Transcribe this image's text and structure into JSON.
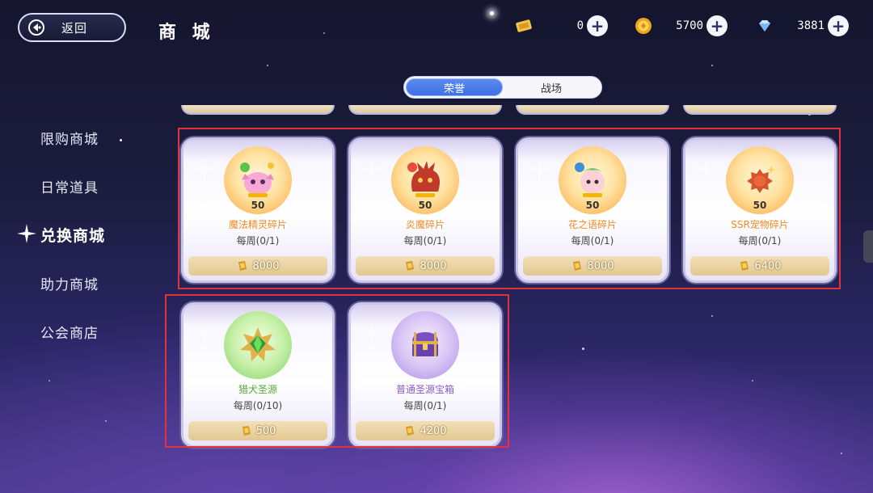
{
  "header": {
    "back_label": "返回",
    "title": "商 城"
  },
  "currencies": [
    {
      "icon": "ticket-icon",
      "value": "0"
    },
    {
      "icon": "gold-coin-icon",
      "value": "5700"
    },
    {
      "icon": "diamond-icon",
      "value": "3881"
    }
  ],
  "tabs": [
    {
      "label": "荣誉",
      "active": true
    },
    {
      "label": "战场",
      "active": false
    }
  ],
  "sidebar": {
    "items": [
      {
        "label": "限购商城"
      },
      {
        "label": "日常道具"
      },
      {
        "label": "兑换商城",
        "active": true
      },
      {
        "label": "助力商城"
      },
      {
        "label": "公会商店"
      }
    ]
  },
  "products": [
    {
      "name": "魔法精灵碎片",
      "count": "50",
      "limit": "每周(0/1)",
      "price": "8000",
      "icon": "pink-spirit-icon"
    },
    {
      "name": "炎魔碎片",
      "count": "50",
      "limit": "每周(0/1)",
      "price": "8000",
      "icon": "fire-demon-icon"
    },
    {
      "name": "花之语碎片",
      "count": "50",
      "limit": "每周(0/1)",
      "price": "8000",
      "icon": "flower-fairy-icon"
    },
    {
      "name": "SSR宠物碎片",
      "count": "50",
      "limit": "每周(0/1)",
      "price": "6400",
      "icon": "ssr-pet-fragment-icon"
    },
    {
      "name": "猎犬圣源",
      "count": "",
      "limit": "每周(0/10)",
      "price": "500",
      "icon": "green-gem-icon"
    },
    {
      "name": "普通圣源宝箱",
      "count": "",
      "limit": "每周(0/1)",
      "price": "4200",
      "icon": "treasure-chest-icon"
    }
  ],
  "colors": {
    "highlight": "#e5313b",
    "tab_active": "#3e6de0",
    "name_orange": "#f08a24",
    "name_green": "#5aa83a",
    "name_purple": "#8a5cc4"
  }
}
